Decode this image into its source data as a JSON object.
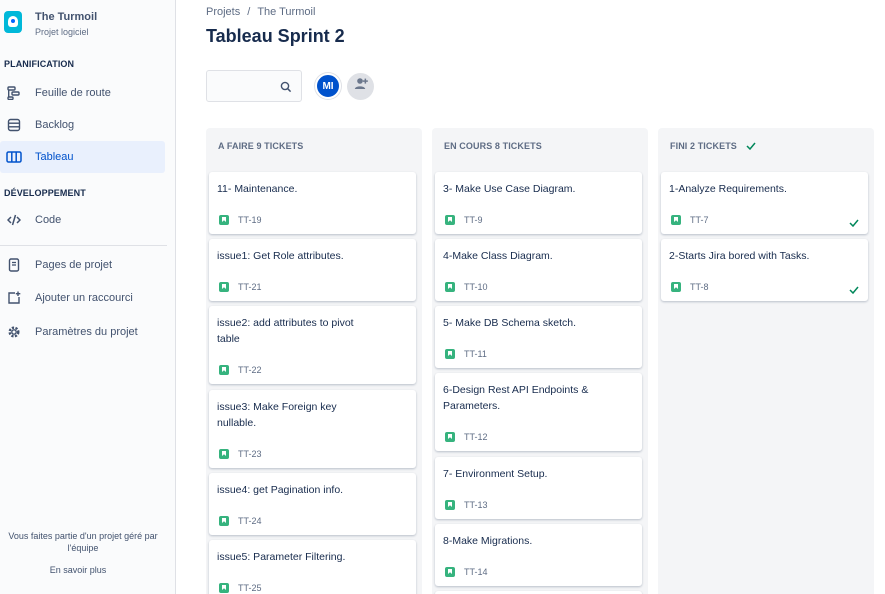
{
  "sidebar": {
    "project_name": "The Turmoil",
    "project_type": "Projet logiciel",
    "planning_label": "PLANIFICATION",
    "planning_items": [
      {
        "label": "Feuille de route",
        "icon": "roadmap-icon"
      },
      {
        "label": "Backlog",
        "icon": "backlog-icon"
      },
      {
        "label": "Tableau",
        "icon": "board-icon",
        "active": true
      }
    ],
    "dev_label": "DÉVELOPPEMENT",
    "dev_items": [
      {
        "label": "Code",
        "icon": "code-icon"
      }
    ],
    "other_items": [
      {
        "label": "Pages de projet",
        "icon": "pages-icon"
      },
      {
        "label": "Ajouter un raccourci",
        "icon": "add-shortcut-icon"
      },
      {
        "label": "Paramètres du projet",
        "icon": "settings-icon"
      }
    ],
    "footer_text": "Vous faites partie d'un projet géré par l'équipe",
    "footer_link": "En savoir plus"
  },
  "breadcrumb": {
    "projects": "Projets",
    "separator": "/",
    "project": "The Turmoil"
  },
  "page_title": "Tableau Sprint 2",
  "toolbar": {
    "search_placeholder": "",
    "user_initials": "MI"
  },
  "colors": {
    "accent": "#0052cc",
    "story": "#36b37e",
    "done": "#00875a"
  },
  "columns": [
    {
      "title": "A FAIRE 9 TICKETS",
      "cards": [
        {
          "summary": "11- Maintenance.",
          "key": "TT-19"
        },
        {
          "summary": "issue1: Get Role attributes.",
          "key": "TT-21"
        },
        {
          "summary": "issue2: add attributes to pivot table",
          "key": "TT-22"
        },
        {
          "summary": "issue3: Make Foreign key nullable.",
          "key": "TT-23"
        },
        {
          "summary": "issue4: get Pagination info.",
          "key": "TT-24"
        },
        {
          "summary": "issue5: Parameter Filtering.",
          "key": "TT-25"
        }
      ]
    },
    {
      "title": "EN COURS 8 TICKETS",
      "cards": [
        {
          "summary": "3- Make Use Case Diagram.",
          "key": "TT-9"
        },
        {
          "summary": "4-Make Class Diagram.",
          "key": "TT-10"
        },
        {
          "summary": "5- Make DB Schema sketch.",
          "key": "TT-11"
        },
        {
          "summary": "6-Design Rest API Endpoints & Parameters.",
          "key": "TT-12"
        },
        {
          "summary": "7- Environment Setup.",
          "key": "TT-13"
        },
        {
          "summary": "8-Make Migrations.",
          "key": "TT-14"
        }
      ]
    },
    {
      "title": "FINI 2 TICKETS",
      "cards": [
        {
          "summary": "1-Analyze Requirements.",
          "key": "TT-7"
        },
        {
          "summary": "2-Starts Jira bored with Tasks.",
          "key": "TT-8"
        }
      ]
    }
  ]
}
